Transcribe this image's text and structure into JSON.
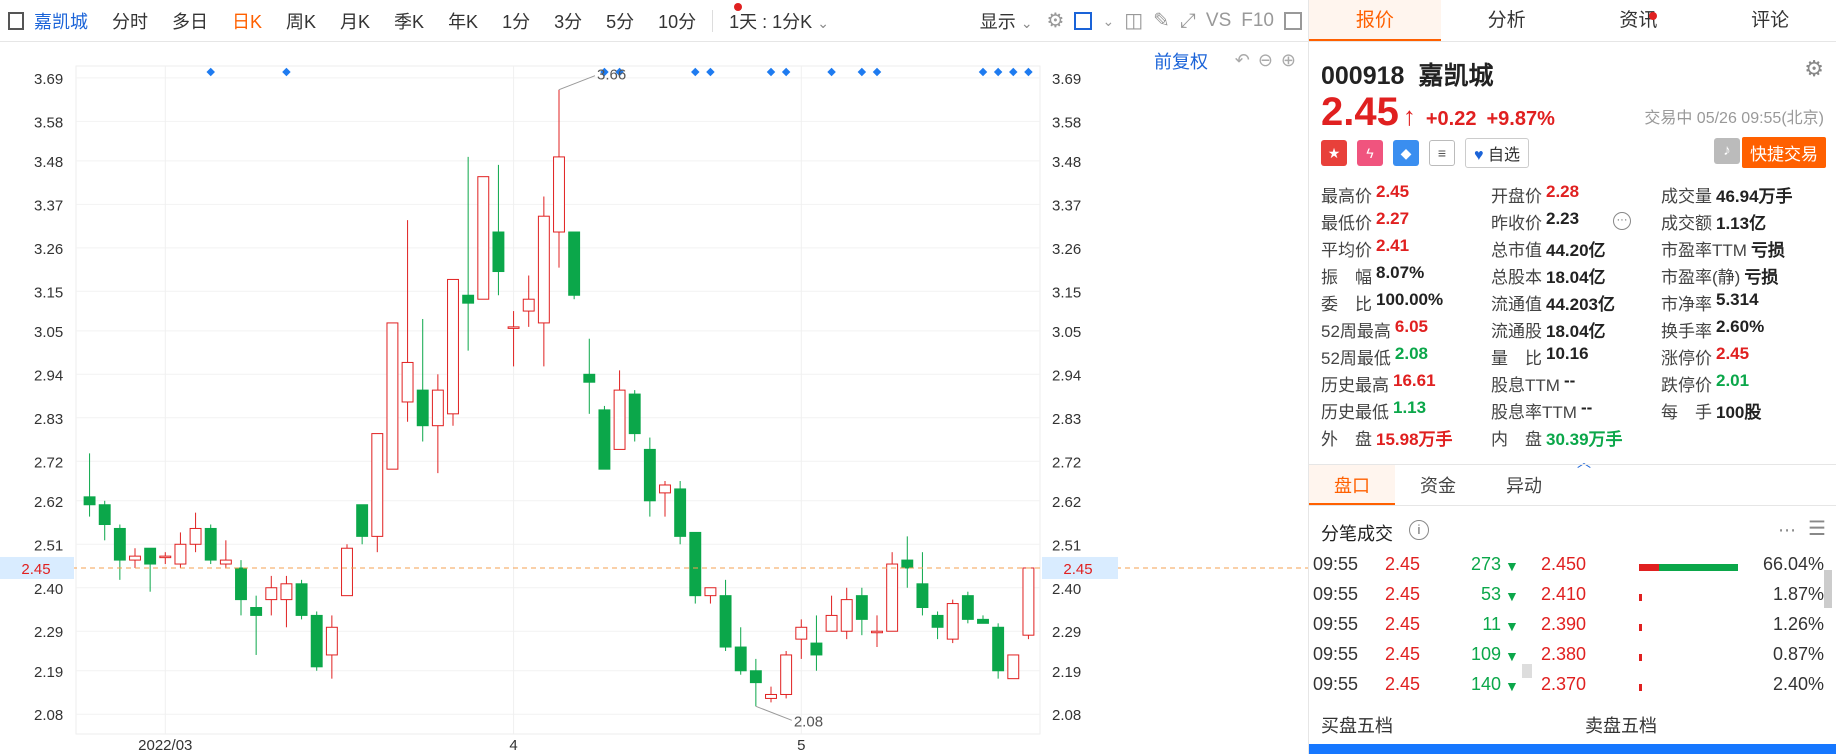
{
  "toolbar": {
    "stock_name": "嘉凯城",
    "periods": [
      "分时",
      "多日",
      "日K",
      "周K",
      "月K",
      "季K",
      "年K",
      "1分",
      "3分",
      "5分",
      "10分"
    ],
    "active_period": "日K",
    "interval_label": "1天 : 1分K",
    "display_label": "显示",
    "vs_label": "VS",
    "f10_label": "F10"
  },
  "chart": {
    "adjust_label": "前复权",
    "current_price_label": "2.45"
  },
  "chart_data": {
    "type": "candlestick",
    "y_ticks": [
      3.69,
      3.58,
      3.48,
      3.37,
      3.26,
      3.15,
      3.05,
      2.94,
      2.83,
      2.72,
      2.62,
      2.51,
      2.4,
      2.29,
      2.19,
      2.08
    ],
    "ylim": [
      2.03,
      3.72
    ],
    "x_labels": [
      "2022/03",
      "4",
      "5"
    ],
    "max_label": "3.66",
    "min_label": "2.08",
    "current_price": 2.45,
    "candles": [
      {
        "o": 2.63,
        "c": 2.61,
        "h": 2.74,
        "l": 2.58
      },
      {
        "o": 2.61,
        "c": 2.56,
        "h": 2.62,
        "l": 2.52
      },
      {
        "o": 2.55,
        "c": 2.47,
        "h": 2.56,
        "l": 2.42
      },
      {
        "o": 2.47,
        "c": 2.48,
        "h": 2.5,
        "l": 2.45
      },
      {
        "o": 2.5,
        "c": 2.46,
        "h": 2.5,
        "l": 2.39
      },
      {
        "o": 2.48,
        "c": 2.48,
        "h": 2.49,
        "l": 2.46
      },
      {
        "o": 2.46,
        "c": 2.51,
        "h": 2.54,
        "l": 2.45
      },
      {
        "o": 2.51,
        "c": 2.55,
        "h": 2.59,
        "l": 2.49
      },
      {
        "o": 2.55,
        "c": 2.47,
        "h": 2.56,
        "l": 2.46
      },
      {
        "o": 2.46,
        "c": 2.47,
        "h": 2.52,
        "l": 2.45
      },
      {
        "o": 2.45,
        "c": 2.37,
        "h": 2.47,
        "l": 2.33
      },
      {
        "o": 2.35,
        "c": 2.33,
        "h": 2.38,
        "l": 2.23
      },
      {
        "o": 2.37,
        "c": 2.4,
        "h": 2.43,
        "l": 2.33
      },
      {
        "o": 2.37,
        "c": 2.41,
        "h": 2.43,
        "l": 2.3
      },
      {
        "o": 2.41,
        "c": 2.33,
        "h": 2.42,
        "l": 2.32
      },
      {
        "o": 2.33,
        "c": 2.2,
        "h": 2.34,
        "l": 2.19
      },
      {
        "o": 2.23,
        "c": 2.3,
        "h": 2.33,
        "l": 2.17
      },
      {
        "o": 2.38,
        "c": 2.5,
        "h": 2.51,
        "l": 2.38
      },
      {
        "o": 2.61,
        "c": 2.53,
        "h": 2.61,
        "l": 2.51
      },
      {
        "o": 2.53,
        "c": 2.79,
        "h": 2.79,
        "l": 2.49
      },
      {
        "o": 2.7,
        "c": 3.07,
        "h": 3.07,
        "l": 2.7
      },
      {
        "o": 2.87,
        "c": 2.97,
        "h": 3.33,
        "l": 2.82
      },
      {
        "o": 2.9,
        "c": 2.81,
        "h": 3.08,
        "l": 2.77
      },
      {
        "o": 2.81,
        "c": 2.9,
        "h": 2.94,
        "l": 2.69
      },
      {
        "o": 2.84,
        "c": 3.18,
        "h": 3.18,
        "l": 2.81
      },
      {
        "o": 3.14,
        "c": 3.12,
        "h": 3.49,
        "l": 3.0
      },
      {
        "o": 3.13,
        "c": 3.44,
        "h": 3.44,
        "l": 3.13
      },
      {
        "o": 3.3,
        "c": 3.2,
        "h": 3.47,
        "l": 3.14
      },
      {
        "o": 3.06,
        "c": 3.06,
        "h": 3.1,
        "l": 2.96
      },
      {
        "o": 3.1,
        "c": 3.13,
        "h": 3.19,
        "l": 3.06
      },
      {
        "o": 3.07,
        "c": 3.34,
        "h": 3.39,
        "l": 2.96
      },
      {
        "o": 3.3,
        "c": 3.49,
        "h": 3.66,
        "l": 3.21
      },
      {
        "o": 3.3,
        "c": 3.14,
        "h": 3.3,
        "l": 3.13
      },
      {
        "o": 2.94,
        "c": 2.92,
        "h": 3.03,
        "l": 2.84
      },
      {
        "o": 2.85,
        "c": 2.7,
        "h": 2.86,
        "l": 2.7
      },
      {
        "o": 2.75,
        "c": 2.9,
        "h": 2.95,
        "l": 2.75
      },
      {
        "o": 2.89,
        "c": 2.79,
        "h": 2.9,
        "l": 2.77
      },
      {
        "o": 2.75,
        "c": 2.62,
        "h": 2.78,
        "l": 2.58
      },
      {
        "o": 2.64,
        "c": 2.66,
        "h": 2.67,
        "l": 2.58
      },
      {
        "o": 2.65,
        "c": 2.53,
        "h": 2.67,
        "l": 2.51
      },
      {
        "o": 2.54,
        "c": 2.38,
        "h": 2.54,
        "l": 2.36
      },
      {
        "o": 2.38,
        "c": 2.4,
        "h": 2.4,
        "l": 2.36
      },
      {
        "o": 2.38,
        "c": 2.25,
        "h": 2.42,
        "l": 2.24
      },
      {
        "o": 2.25,
        "c": 2.19,
        "h": 2.3,
        "l": 2.18
      },
      {
        "o": 2.19,
        "c": 2.16,
        "h": 2.22,
        "l": 2.1
      },
      {
        "o": 2.12,
        "c": 2.13,
        "h": 2.15,
        "l": 2.11
      },
      {
        "o": 2.13,
        "c": 2.23,
        "h": 2.24,
        "l": 2.12
      },
      {
        "o": 2.27,
        "c": 2.3,
        "h": 2.32,
        "l": 2.22
      },
      {
        "o": 2.26,
        "c": 2.23,
        "h": 2.33,
        "l": 2.19
      },
      {
        "o": 2.29,
        "c": 2.33,
        "h": 2.38,
        "l": 2.29
      },
      {
        "o": 2.29,
        "c": 2.37,
        "h": 2.4,
        "l": 2.27
      },
      {
        "o": 2.38,
        "c": 2.32,
        "h": 2.4,
        "l": 2.28
      },
      {
        "o": 2.29,
        "c": 2.29,
        "h": 2.33,
        "l": 2.25
      },
      {
        "o": 2.29,
        "c": 2.46,
        "h": 2.49,
        "l": 2.29
      },
      {
        "o": 2.47,
        "c": 2.45,
        "h": 2.53,
        "l": 2.4
      },
      {
        "o": 2.41,
        "c": 2.35,
        "h": 2.49,
        "l": 2.33
      },
      {
        "o": 2.33,
        "c": 2.3,
        "h": 2.34,
        "l": 2.27
      },
      {
        "o": 2.27,
        "c": 2.36,
        "h": 2.37,
        "l": 2.26
      },
      {
        "o": 2.38,
        "c": 2.32,
        "h": 2.39,
        "l": 2.31
      },
      {
        "o": 2.32,
        "c": 2.31,
        "h": 2.33,
        "l": 2.31
      },
      {
        "o": 2.3,
        "c": 2.19,
        "h": 2.31,
        "l": 2.17
      },
      {
        "o": 2.17,
        "c": 2.23,
        "h": 2.23,
        "l": 2.17
      },
      {
        "o": 2.28,
        "c": 2.45,
        "h": 2.45,
        "l": 2.27
      }
    ],
    "markers_at": [
      8,
      13,
      34,
      35,
      40,
      41,
      45,
      46,
      49,
      51,
      52,
      59,
      60,
      61,
      62
    ]
  },
  "panel": {
    "tabs": [
      "报价",
      "分析",
      "资讯",
      "评论"
    ],
    "active_tab": "报价",
    "code": "000918",
    "name": "嘉凯城",
    "price": "2.45",
    "change": "+0.22",
    "change_pct": "+9.87%",
    "status_time": "交易中 05/26 09:55(北京)",
    "watch_label": "自选",
    "quick_trade_label": "快捷交易",
    "colors": {
      "up": "#e02020",
      "down": "#0ba74a",
      "accent": "#ff6000"
    },
    "quote_rows": [
      [
        {
          "k": "最高价",
          "v": "2.45",
          "c": "up"
        },
        {
          "k": "开盘价",
          "v": "2.28",
          "c": "up"
        },
        {
          "k": "成交量",
          "v": "46.94万手",
          "c": "nt"
        }
      ],
      [
        {
          "k": "最低价",
          "v": "2.27",
          "c": "up"
        },
        {
          "k": "昨收价",
          "v": "2.23",
          "c": "nt"
        },
        {
          "k": "成交额",
          "v": "1.13亿",
          "c": "nt"
        }
      ],
      [
        {
          "k": "平均价",
          "v": "2.41",
          "c": "up"
        },
        {
          "k": "总市值",
          "v": "44.20亿",
          "c": "nt"
        },
        {
          "k": "市盈率TTM",
          "v": "亏损",
          "c": "nt"
        }
      ],
      [
        {
          "k": "振　幅",
          "v": "8.07%",
          "c": "nt"
        },
        {
          "k": "总股本",
          "v": "18.04亿",
          "c": "nt"
        },
        {
          "k": "市盈率(静)",
          "v": "亏损",
          "c": "nt"
        }
      ],
      [
        {
          "k": "委　比",
          "v": "100.00%",
          "c": "nt"
        },
        {
          "k": "流通值",
          "v": "44.203亿",
          "c": "nt"
        },
        {
          "k": "市净率",
          "v": "5.314",
          "c": "nt"
        }
      ],
      [
        {
          "k": "52周最高",
          "v": "6.05",
          "c": "up"
        },
        {
          "k": "流通股",
          "v": "18.04亿",
          "c": "nt"
        },
        {
          "k": "换手率",
          "v": "2.60%",
          "c": "nt"
        }
      ],
      [
        {
          "k": "52周最低",
          "v": "2.08",
          "c": "dn"
        },
        {
          "k": "量　比",
          "v": "10.16",
          "c": "nt"
        },
        {
          "k": "涨停价",
          "v": "2.45",
          "c": "up"
        }
      ],
      [
        {
          "k": "历史最高",
          "v": "16.61",
          "c": "up"
        },
        {
          "k": "股息TTM",
          "v": "--",
          "c": "nt"
        },
        {
          "k": "跌停价",
          "v": "2.01",
          "c": "dn"
        }
      ],
      [
        {
          "k": "历史最低",
          "v": "1.13",
          "c": "dn"
        },
        {
          "k": "股息率TTM",
          "v": "--",
          "c": "nt"
        },
        {
          "k": "每　手",
          "v": "100股",
          "c": "nt"
        }
      ],
      [
        {
          "k": "外　盘",
          "v": "15.98万手",
          "c": "up"
        },
        {
          "k": "内　盘",
          "v": "30.39万手",
          "c": "dn"
        },
        {
          "k": "",
          "v": "",
          "c": "nt"
        }
      ]
    ],
    "sub_tabs": [
      "盘口",
      "资金",
      "异动"
    ],
    "active_sub_tab": "盘口",
    "ticks_title": "分笔成交",
    "ticks": [
      {
        "time": "09:55",
        "price": "2.45",
        "vol": "273"
      },
      {
        "time": "09:55",
        "price": "2.45",
        "vol": "53"
      },
      {
        "time": "09:55",
        "price": "2.45",
        "vol": "11"
      },
      {
        "time": "09:55",
        "price": "2.45",
        "vol": "109"
      },
      {
        "time": "09:55",
        "price": "2.45",
        "vol": "140"
      }
    ],
    "levels": [
      {
        "price": "2.450",
        "pct": "66.04%",
        "share": 0.6604
      },
      {
        "price": "2.410",
        "pct": "1.87%",
        "share": 0.0187
      },
      {
        "price": "2.390",
        "pct": "1.26%",
        "share": 0.0126
      },
      {
        "price": "2.380",
        "pct": "0.87%",
        "share": 0.0087
      },
      {
        "price": "2.370",
        "pct": "2.40%",
        "share": 0.024
      }
    ],
    "buy_five": "买盘五档",
    "sell_five": "卖盘五档"
  }
}
